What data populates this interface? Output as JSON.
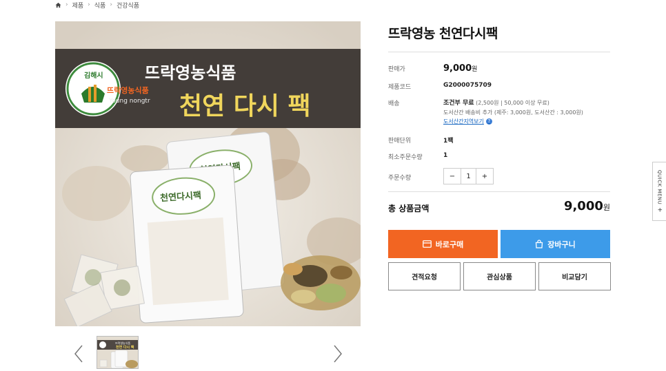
{
  "breadcrumb": {
    "items": [
      "제품",
      "식품",
      "건강식품"
    ]
  },
  "product": {
    "title": "뜨락영농 천연다시팩",
    "banner": {
      "brand_title": "뜨락영농식품",
      "product_title": "천연 다시 팩",
      "seal_text": "김해시",
      "logo_text": "뜨락영농식품",
      "logo_sub": "Young nongtr",
      "bag_label": "천연다시팩"
    }
  },
  "info": {
    "price_label": "판매가",
    "price": "9,000",
    "won": "원",
    "code_label": "제품코드",
    "code": "G2000075709",
    "ship_label": "배송",
    "ship_main": "조건부 무료",
    "ship_detail": "(2,500원 | 50,000 이상 무료)",
    "ship_extra": "도서산간 배송비 추가 (제주: 3,000원, 도서산간 : 3,000원)",
    "ship_link": "도서산간지역보기",
    "ship_help": "?",
    "unit_label": "판매단위",
    "unit": "1팩",
    "min_label": "최소주문수량",
    "min_qty": "1",
    "order_label": "주문수량",
    "qty_minus": "−",
    "qty_value": "1",
    "qty_plus": "+"
  },
  "total": {
    "label": "총 상품금액",
    "price": "9,000",
    "won": "원"
  },
  "buttons": {
    "buy": "바로구매",
    "cart": "장바구니",
    "quote": "견적요청",
    "wish": "관심상품",
    "compare": "비교담기"
  },
  "quick_menu": {
    "label": "QUICK MENU",
    "plus": "+"
  },
  "colors": {
    "buy": "#f26522",
    "cart": "#3d9be9"
  }
}
